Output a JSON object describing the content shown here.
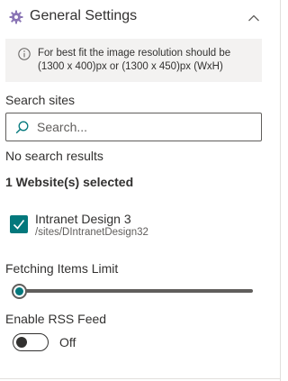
{
  "section": {
    "title": "General Settings",
    "icon": "gear-icon",
    "expanded": true
  },
  "info": {
    "message": "For best fit the image resolution should be (1300 x 400)px or (1300 x 450)px (WxH)"
  },
  "search": {
    "label": "Search sites",
    "placeholder": "Search...",
    "value": "",
    "results_text": "No search results"
  },
  "selection": {
    "summary": "1 Website(s) selected",
    "sites": [
      {
        "name": "Intranet Design 3",
        "path": "/sites/DIntranetDesign32",
        "checked": true
      }
    ]
  },
  "fetch_limit": {
    "label": "Fetching Items Limit",
    "value_fraction": 0.0
  },
  "rss": {
    "label": "Enable RSS Feed",
    "state": "Off",
    "enabled": false
  },
  "colors": {
    "accent": "#03787c",
    "text": "#323130",
    "info_background": "#f3f2f1"
  }
}
